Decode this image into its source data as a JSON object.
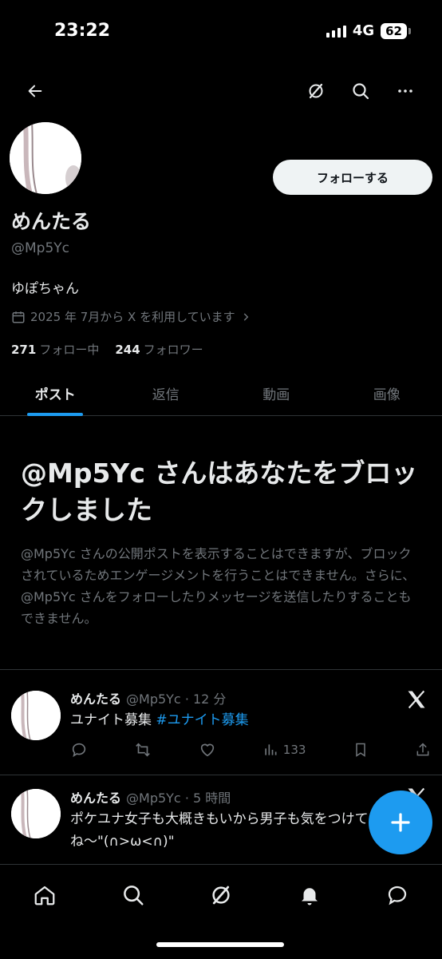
{
  "status_bar": {
    "time": "23:22",
    "network": "4G",
    "battery": "62"
  },
  "nav": {
    "icons": [
      "back-arrow-icon",
      "grok-icon",
      "search-icon",
      "more-icon"
    ]
  },
  "profile": {
    "display_name": "めんたる",
    "handle": "@Mp5Yc",
    "bio": "ゆぽちゃん",
    "joined": "2025 年 7月から X を利用しています",
    "following_count": "271",
    "following_label": "フォロー中",
    "followers_count": "244",
    "followers_label": "フォロワー",
    "follow_button": "フォローする"
  },
  "tabs": [
    {
      "label": "ポスト",
      "active": true
    },
    {
      "label": "返信",
      "active": false
    },
    {
      "label": "動画",
      "active": false
    },
    {
      "label": "画像",
      "active": false
    }
  ],
  "blocked": {
    "title": "@Mp5Yc さんはあなたをブロックしました",
    "body": "@Mp5Yc さんの公開ポストを表示することはできますが、ブロックされているためエンゲージメントを行うことはできません。さらに、@Mp5Yc さんをフォローしたりメッセージを送信したりすることもできません。"
  },
  "posts": [
    {
      "name": "めんたる",
      "meta": "@Mp5Yc · 12 分",
      "text": "ユナイト募集 ",
      "hashtag": "#ユナイト募集",
      "views": "133"
    },
    {
      "name": "めんたる",
      "meta": "@Mp5Yc · 5 時間",
      "text": "ポケユナ女子も大概きもいから男子も気をつけてね〜\"(∩>ω<∩)\""
    }
  ],
  "colors": {
    "accent": "#1d9bf0",
    "background": "#000000",
    "secondary_text": "#71767b",
    "divider": "#2f3336"
  }
}
